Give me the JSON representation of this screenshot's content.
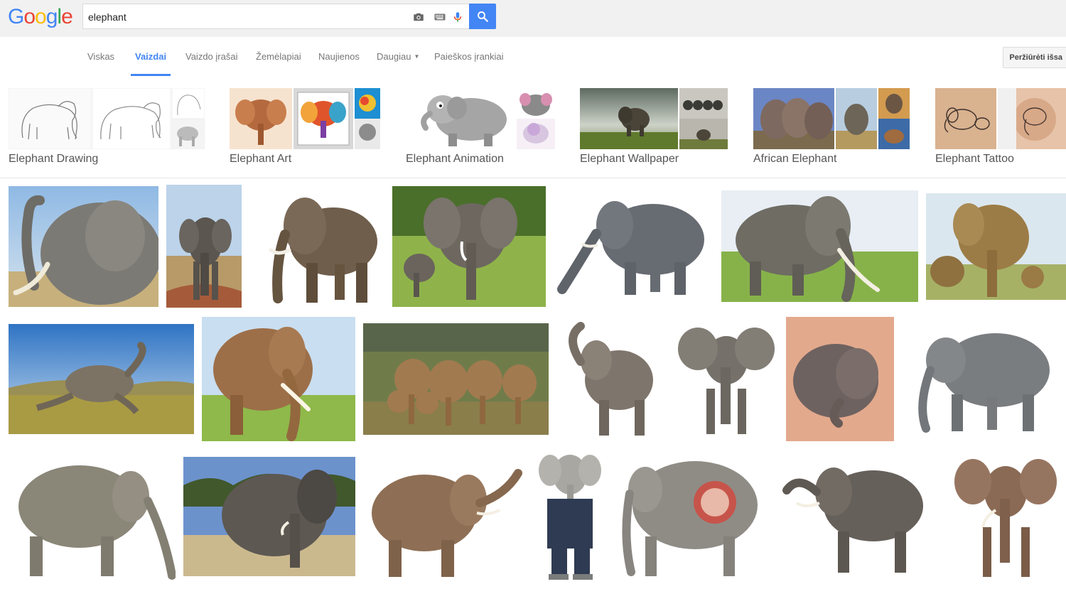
{
  "header": {
    "logo_text": [
      "G",
      "o",
      "o",
      "g",
      "l",
      "e"
    ],
    "logo_colors": [
      "#4285F4",
      "#EA4335",
      "#FBBC05",
      "#4285F4",
      "#34A853",
      "#EA4335"
    ],
    "search_query": "elephant",
    "icons": [
      "camera-icon",
      "keyboard-icon",
      "microphone-icon",
      "search-icon"
    ]
  },
  "nav": {
    "tabs": [
      "Viskas",
      "Vaizdai",
      "Vaizdo įrašai",
      "Žemėlapiai",
      "Naujienos",
      "Daugiau",
      "Paieškos įrankiai"
    ],
    "active_tab": "Vaizdai",
    "view_button": "Peržiūrėti išsa"
  },
  "chips": [
    {
      "label": "Elephant Drawing"
    },
    {
      "label": "Elephant Art"
    },
    {
      "label": "Elephant Animation"
    },
    {
      "label": "Elephant Wallpaper"
    },
    {
      "label": "African Elephant"
    },
    {
      "label": "Elephant Tattoo"
    }
  ],
  "colors": {
    "accent": "#4285f4",
    "header_bg": "#f1f1f1",
    "elephant_gray": "#7d7d78",
    "elephant_brown": "#8b6f54",
    "sky": "#a9c8e8",
    "grass": "#7aa83a",
    "savanna": "#c9b26a"
  }
}
